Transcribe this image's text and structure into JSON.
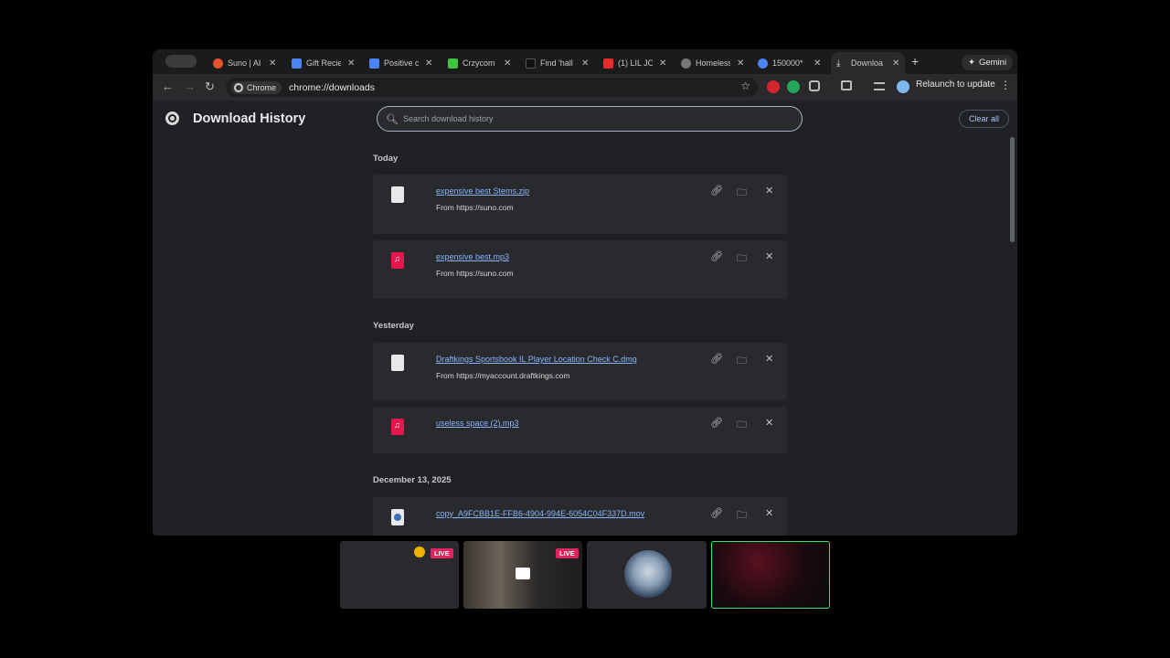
{
  "tabs": [
    {
      "title": "Suno | AI",
      "color": "#e8522e"
    },
    {
      "title": "Gift Recie",
      "color": "#4a84f2"
    },
    {
      "title": "Positive c",
      "color": "#4a84f2"
    },
    {
      "title": "Crzycom",
      "color": "#3ec43e"
    },
    {
      "title": "Find 'hall",
      "color": "#111111"
    },
    {
      "title": "(1) LIL JO",
      "color": "#e52d2d"
    },
    {
      "title": "Homeless",
      "color": "#777777"
    },
    {
      "title": "150000*",
      "color": "#4a84f2"
    },
    {
      "title": "Downloa",
      "color": "#cccccc"
    }
  ],
  "toolbar": {
    "chip_label": "Chrome",
    "url": "chrome://downloads",
    "relaunch_label": "Relaunch to update",
    "gemini_label": "Gemini"
  },
  "page": {
    "title": "Download History",
    "search_placeholder": "Search download history",
    "clear_all": "Clear all"
  },
  "sections": [
    {
      "label": "Today"
    },
    {
      "label": "Yesterday"
    },
    {
      "label": "December 13, 2025"
    }
  ],
  "downloads": [
    {
      "name": "expensive best Stems.zip",
      "source": "From https://suno.com",
      "type": "zip"
    },
    {
      "name": "expensive best.mp3",
      "source": "From https://suno.com",
      "type": "audio"
    },
    {
      "name": "Draftkings Sportsbook IL Player Location Check C.dmg",
      "source": "From https://myaccount.draftkings.com",
      "type": "doc"
    },
    {
      "name": "useless space (2).mp3",
      "source": "",
      "type": "audio"
    },
    {
      "name": "copy_A9FCBB1E-FFB6-4904-994E-6054C04F337D.mov",
      "source": "",
      "type": "mov"
    }
  ],
  "thumbnails": {
    "live_label": "LIVE"
  },
  "colors": {
    "link": "#8ab4f8",
    "accent_blue": "#a8c7fa",
    "live_red": "#e0245e"
  }
}
